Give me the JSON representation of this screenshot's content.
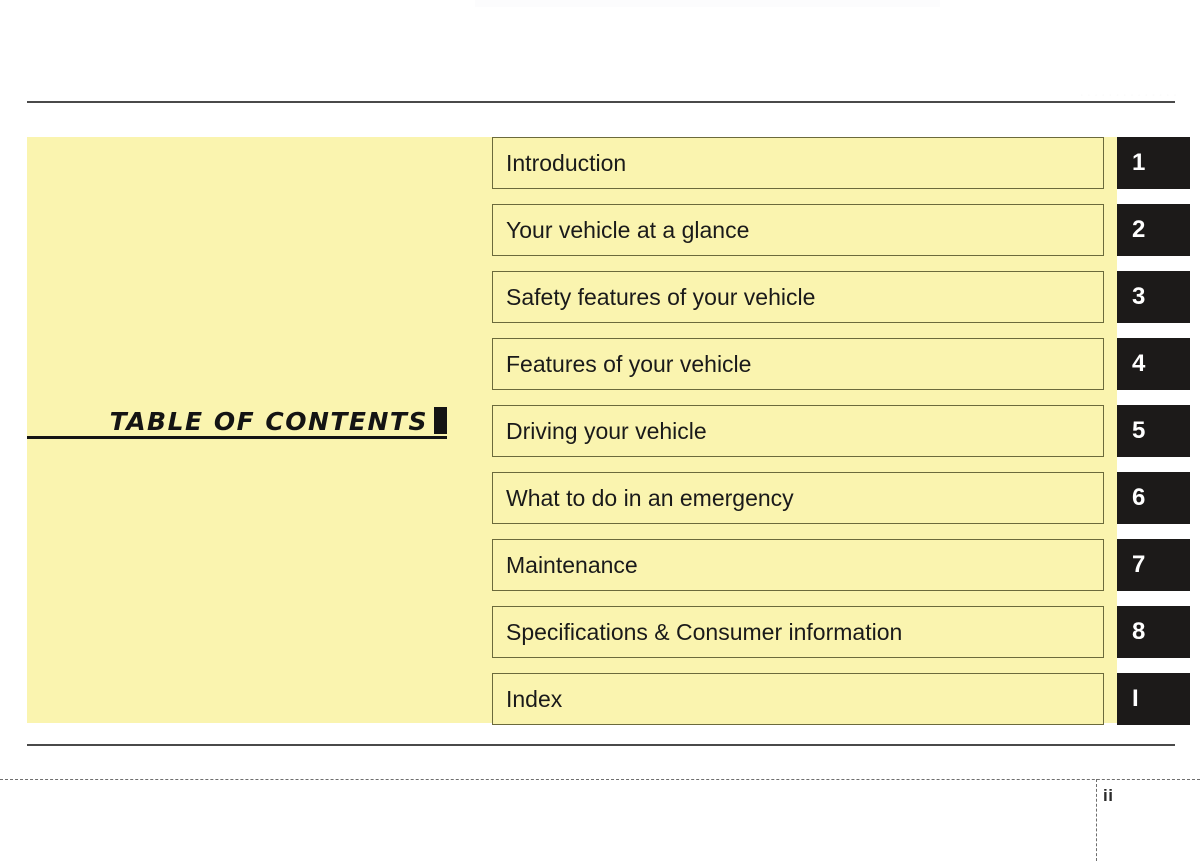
{
  "page": {
    "title": "TABLE OF CONTENTS",
    "page_number": "ii",
    "ghost_header": "..............",
    "colors": {
      "panel_yellow": "#FAF4AF",
      "row_border": "#6b6a3c",
      "tab_black": "#1c1a19",
      "rule_gray": "#4a4a4a",
      "text_black": "#1a1a1a",
      "tab_number_white": "#ffffff"
    }
  },
  "contents": {
    "rows": [
      {
        "label": "Introduction",
        "tab": "1"
      },
      {
        "label": "Your vehicle at a glance",
        "tab": "2"
      },
      {
        "label": "Safety features of your vehicle",
        "tab": "3"
      },
      {
        "label": "Features of your vehicle",
        "tab": "4"
      },
      {
        "label": "Driving your vehicle",
        "tab": "5"
      },
      {
        "label": "What to do in an emergency",
        "tab": "6"
      },
      {
        "label": "Maintenance",
        "tab": "7"
      },
      {
        "label": "Specifications & Consumer information",
        "tab": "8"
      },
      {
        "label": "Index",
        "tab": "I"
      }
    ]
  }
}
